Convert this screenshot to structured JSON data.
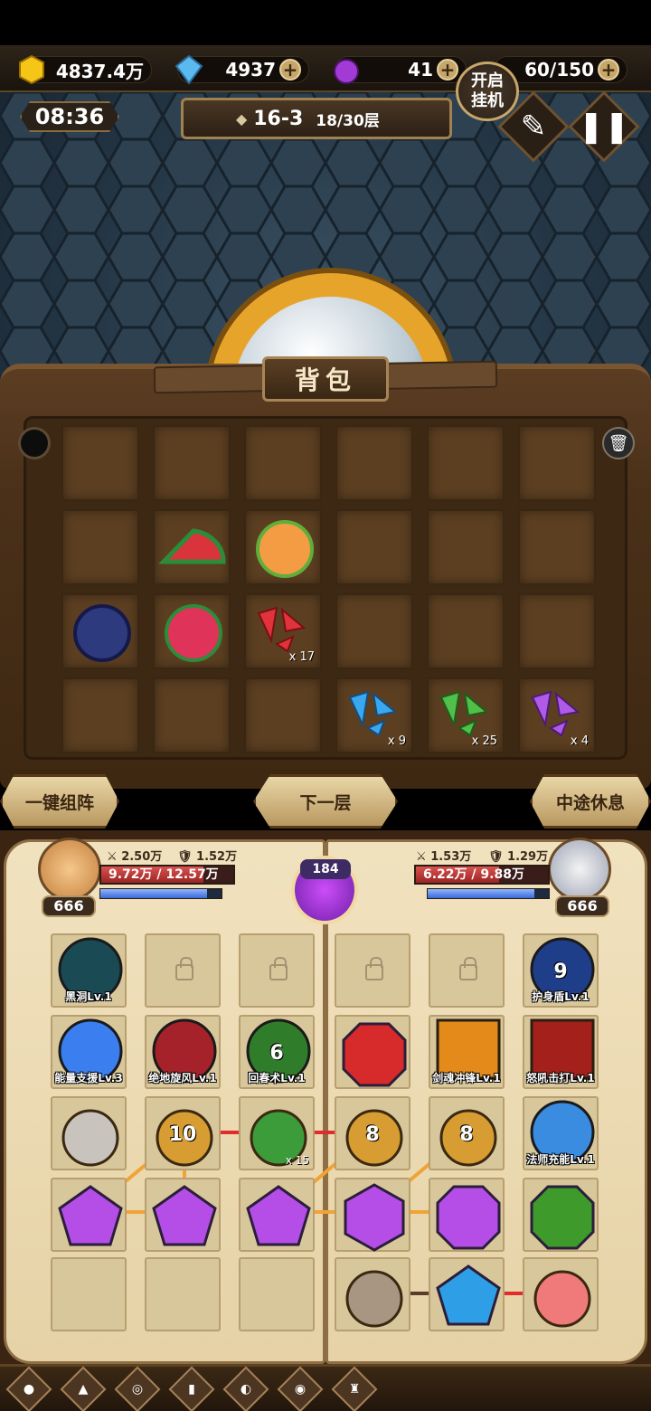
{
  "resources": {
    "gold": "4837.4万",
    "diamond": "4937",
    "potion": "41",
    "stamina": "60/150"
  },
  "hud": {
    "timer": "08:36",
    "stage": "16-3",
    "floor": "18/30层",
    "afk_label_1": "开启",
    "afk_label_2": "挂机"
  },
  "backpack": {
    "title": "背包",
    "items": [
      {
        "row": 1,
        "col": 1,
        "item": "watermelon"
      },
      {
        "row": 1,
        "col": 2,
        "item": "orange-slice"
      },
      {
        "row": 2,
        "col": 0,
        "item": "blackberry"
      },
      {
        "row": 2,
        "col": 1,
        "item": "dragonfruit"
      },
      {
        "row": 2,
        "col": 2,
        "item": "red-shard",
        "qty": "x 17"
      },
      {
        "row": 3,
        "col": 3,
        "item": "blue-shard",
        "qty": "x 9"
      },
      {
        "row": 3,
        "col": 4,
        "item": "green-shard",
        "qty": "x 25"
      },
      {
        "row": 3,
        "col": 5,
        "item": "purple-shard",
        "qty": "x 4"
      }
    ]
  },
  "actions": {
    "auto_formation": "一键组阵",
    "next_floor": "下一层",
    "rest": "中途休息"
  },
  "hero_left": {
    "attack": "2.50万",
    "defense": "1.52万",
    "hp": "9.72万 / 12.57万",
    "hp_ratio": 0.773,
    "level": "666"
  },
  "hero_right": {
    "attack": "1.53万",
    "defense": "1.29万",
    "hp": "6.22万 / 9.88万",
    "hp_ratio": 0.63,
    "level": "666"
  },
  "crest_value": "184",
  "skills": {
    "black_hole": "黑洞Lv.1",
    "shield": "护身盾Lv.1",
    "shield_num": "9",
    "energy_support": "能量支援Lv.3",
    "ground_whirl": "绝地旋风Lv.1",
    "rejuvenate": "回春术Lv.1",
    "rejuvenate_num": "6",
    "sword_soul": "剑魂冲锋Lv.1",
    "roar_strike": "怒吼击打Lv.1",
    "mage_charge": "法师充能Lv.1"
  },
  "board": {
    "bear_gold_1": "10",
    "bear_gold_2": "8",
    "bear_gold_3": "8",
    "broccoli_qty": "x 15"
  }
}
